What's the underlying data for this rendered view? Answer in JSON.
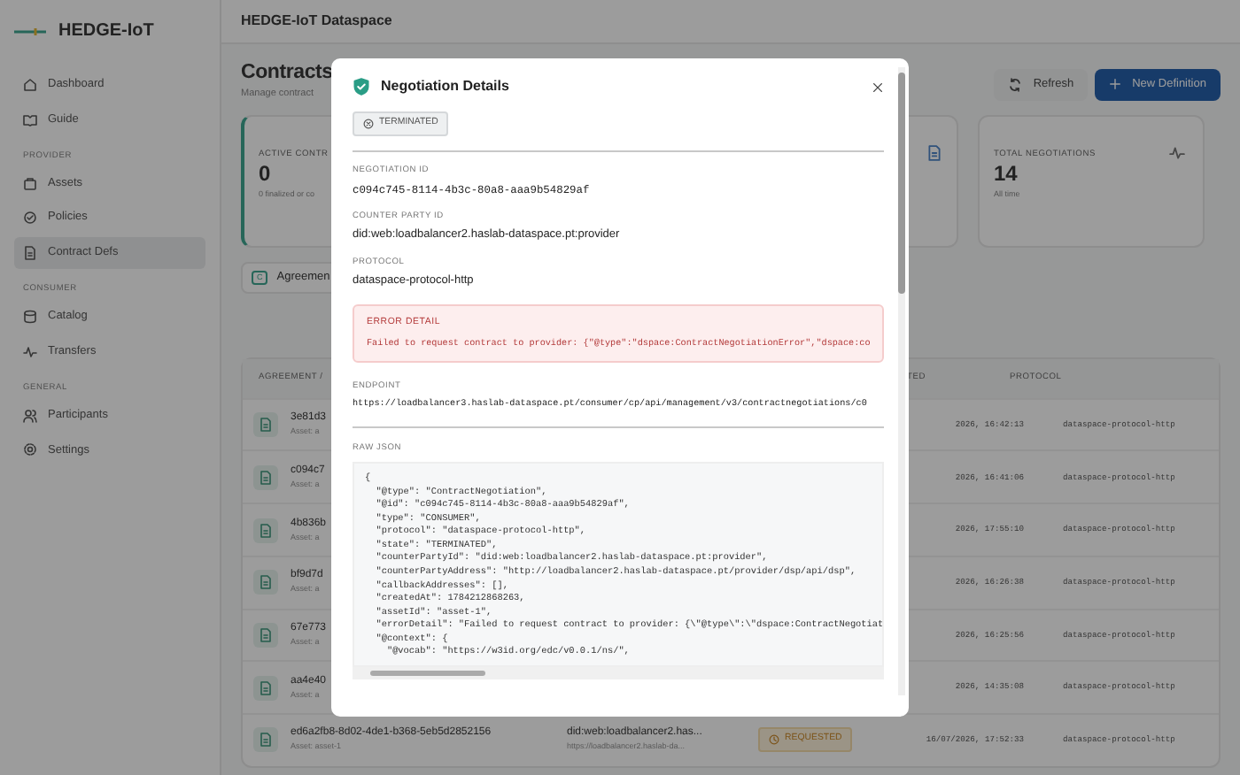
{
  "sidebar": {
    "brand": "HEDGE-IoT",
    "sections": [
      {
        "items": [
          {
            "label": "Dashboard",
            "kind": "home",
            "selected": false
          },
          {
            "label": "Guide",
            "kind": "book",
            "selected": false
          }
        ]
      },
      {
        "heading": "PROVIDER",
        "items": [
          {
            "label": "Assets",
            "kind": "box",
            "selected": false
          },
          {
            "label": "Policies",
            "kind": "shield",
            "selected": false
          },
          {
            "label": "Contract Defs",
            "kind": "file",
            "selected": true
          }
        ]
      },
      {
        "heading": "CONSUMER",
        "items": [
          {
            "label": "Catalog",
            "kind": "db",
            "selected": false
          },
          {
            "label": "Transfers",
            "kind": "pulse",
            "selected": false
          }
        ]
      },
      {
        "heading": "GENERAL",
        "items": [
          {
            "label": "Participants",
            "kind": "users",
            "selected": false
          },
          {
            "label": "Settings",
            "kind": "gear",
            "selected": false
          }
        ]
      }
    ]
  },
  "header": {
    "title": "HEDGE-IoT Dataspace"
  },
  "page": {
    "title": "Contracts",
    "subtitle": "Manage contract",
    "refresh_button": "Refresh",
    "new_button": "New Definition"
  },
  "stats": {
    "left": {
      "label": "ACTIVE CONTR",
      "value": "0",
      "note": "0 finalized or co"
    },
    "right": {
      "label": "TOTAL NEGOTIATIONS",
      "value": "14",
      "note": "All time"
    }
  },
  "tab": {
    "letter": "C",
    "label": "Agreemen"
  },
  "table": {
    "columns": [
      "AGREEMENT / ",
      "TED",
      "PROTOCOL"
    ],
    "rows": [
      {
        "id": "3e81d3",
        "asset": "Asset: a",
        "date": "2026, 16:42:13",
        "protocol": "dataspace-protocol-http"
      },
      {
        "id": "c094c7",
        "asset": "Asset: a",
        "date": "2026, 16:41:06",
        "protocol": "dataspace-protocol-http"
      },
      {
        "id": "4b836b",
        "asset": "Asset: a",
        "date": "2026, 17:55:10",
        "protocol": "dataspace-protocol-http"
      },
      {
        "id": "bf9d7d",
        "asset": "Asset: a",
        "date": "2026, 16:26:38",
        "protocol": "dataspace-protocol-http"
      },
      {
        "id": "67e773",
        "asset": "Asset: a",
        "date": "2026, 16:25:56",
        "protocol": "dataspace-protocol-http"
      },
      {
        "id": "aa4e40",
        "asset": "Asset: a",
        "date": "2026, 14:35:08",
        "protocol": "dataspace-protocol-http"
      },
      {
        "id": "ed6a2fb8-8d02-4de1-b368-5eb5d2852156",
        "asset": "Asset: asset-1",
        "counterparty": "did:web:loadbalancer2.has...",
        "address": "https://loadbalancer2.haslab-da...",
        "status": {
          "label": "REQUESTED",
          "kind": "requested"
        },
        "date": "16/07/2026, 17:52:33",
        "protocol": "dataspace-protocol-http"
      }
    ]
  },
  "modal": {
    "title": "Negotiation Details",
    "status": {
      "label": "TERMINATED",
      "kind": "terminated"
    },
    "fields": [
      {
        "label": "NEGOTIATION ID",
        "value": "c094c745-8114-4b3c-80a8-aaa9b54829af",
        "kind": "mono"
      },
      {
        "label": "COUNTER PARTY ID",
        "value": "did:web:loadbalancer2.haslab-dataspace.pt:provider",
        "kind": "text"
      },
      {
        "label": "PROTOCOL",
        "value": "dataspace-protocol-http",
        "kind": "text"
      }
    ],
    "error": {
      "label": "ERROR DETAIL",
      "text": "Failed to request contract to provider: {\"@type\":\"dspace:ContractNegotiationError\",\"dspace:co"
    },
    "endpoint": {
      "label": "ENDPOINT",
      "value": "https://loadbalancer3.haslab-dataspace.pt/consumer/cp/api/management/v3/contractnegotiations/c0"
    },
    "raw_json": {
      "label": "RAW JSON",
      "lines": [
        "{",
        "  \"@type\": \"ContractNegotiation\",",
        "  \"@id\": \"c094c745-8114-4b3c-80a8-aaa9b54829af\",",
        "  \"type\": \"CONSUMER\",",
        "  \"protocol\": \"dataspace-protocol-http\",",
        "  \"state\": \"TERMINATED\",",
        "  \"counterPartyId\": \"did:web:loadbalancer2.haslab-dataspace.pt:provider\",",
        "  \"counterPartyAddress\": \"http://loadbalancer2.haslab-dataspace.pt/provider/dsp/api/dsp\",",
        "  \"callbackAddresses\": [],",
        "  \"createdAt\": 1784212868263,",
        "  \"assetId\": \"asset-1\",",
        "  \"errorDetail\": \"Failed to request contract to provider: {\\\"@type\\\":\\\"dspace:ContractNegotiat",
        "  \"@context\": {",
        "    \"@vocab\": \"https://w3id.org/edc/v0.0.1/ns/\","
      ]
    }
  }
}
